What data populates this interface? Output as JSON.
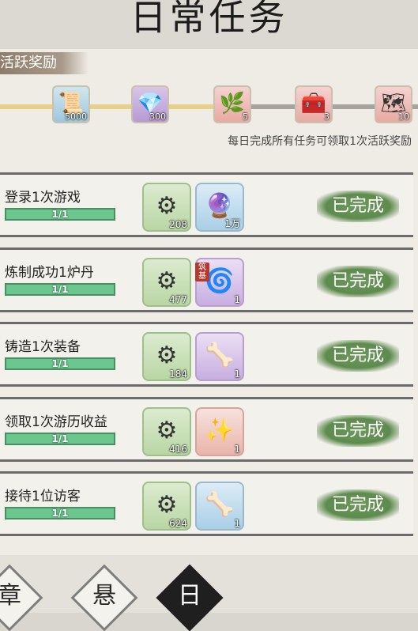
{
  "title": "日常任务",
  "section_label": "活跃奖励",
  "milestones": [
    {
      "icon": "scroll-icon",
      "glyph": "📜",
      "count": "5000"
    },
    {
      "icon": "ore-icon",
      "glyph": "💎",
      "count": "300"
    },
    {
      "icon": "herb-icon",
      "glyph": "🌿",
      "count": "5"
    },
    {
      "icon": "chest-icon",
      "glyph": "🧰",
      "count": "3"
    },
    {
      "icon": "map-icon",
      "glyph": "🗺",
      "count": "10"
    }
  ],
  "activity_progress": 0.6,
  "hint": "每日完成所有任务可领取1次活跃奖励",
  "tasks": [
    {
      "name": "登录1次游戏",
      "progress": "1/1",
      "rewards": [
        {
          "glyph": "⚙",
          "count": "208",
          "icon": "spirit-stone-icon"
        },
        {
          "glyph": "🔮",
          "count": "1万",
          "icon": "crystal-icon"
        }
      ],
      "status": "已完成"
    },
    {
      "name": "炼制成功1炉丹",
      "progress": "1/1",
      "rewards": [
        {
          "glyph": "⚙",
          "count": "477",
          "icon": "spirit-stone-icon"
        },
        {
          "glyph": "🌀",
          "count": "1",
          "icon": "pill-icon",
          "badge": "筑基"
        }
      ],
      "status": "已完成"
    },
    {
      "name": "铸造1次装备",
      "progress": "1/1",
      "rewards": [
        {
          "glyph": "⚙",
          "count": "184",
          "icon": "spirit-stone-icon"
        },
        {
          "glyph": "🦴",
          "count": "1",
          "icon": "horn-icon"
        }
      ],
      "status": "已完成"
    },
    {
      "name": "领取1次游历收益",
      "progress": "1/1",
      "rewards": [
        {
          "glyph": "⚙",
          "count": "416",
          "icon": "spirit-stone-icon"
        },
        {
          "glyph": "✨",
          "count": "1",
          "icon": "purple-crystal-icon"
        }
      ],
      "status": "已完成"
    },
    {
      "name": "接待1位访客",
      "progress": "1/1",
      "rewards": [
        {
          "glyph": "⚙",
          "count": "624",
          "icon": "spirit-stone-icon"
        },
        {
          "glyph": "🦴",
          "count": "1",
          "icon": "horn-icon"
        }
      ],
      "status": "已完成"
    }
  ],
  "nav": [
    {
      "label": "章",
      "name": "nav-chapter"
    },
    {
      "label": "悬",
      "name": "nav-bounty"
    },
    {
      "label": "日",
      "name": "nav-daily"
    }
  ]
}
